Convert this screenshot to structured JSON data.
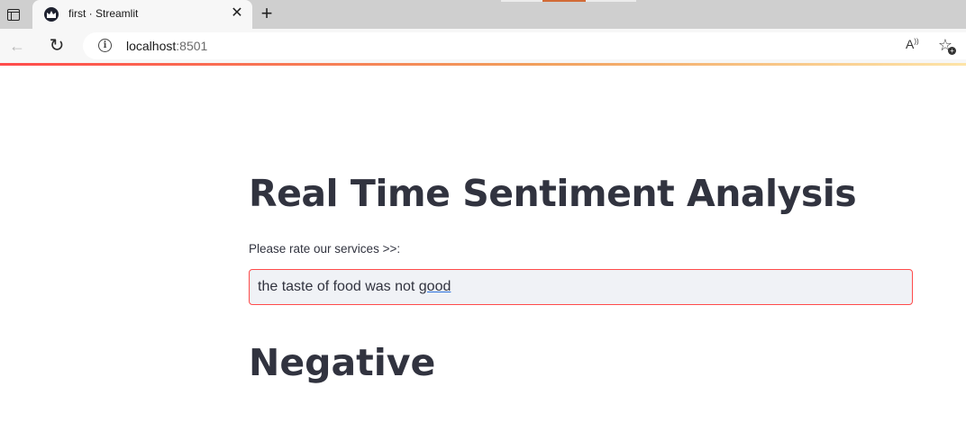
{
  "browser": {
    "tab": {
      "title": "first · Streamlit",
      "close_glyph": "✕"
    },
    "new_tab_glyph": "+",
    "back_glyph": "←",
    "reload_glyph": "↻",
    "info_glyph": "i",
    "address": {
      "host": "localhost",
      "port": ":8501"
    },
    "read_aloud_glyph": "A",
    "favorites_glyph": "☆",
    "favorites_plus": "+"
  },
  "app": {
    "title": "Real Time Sentiment Analysis",
    "input_label": "Please rate our services >>:",
    "input_value_plain": "the taste of food was not ",
    "input_value_flagged": "good",
    "result": "Negative",
    "colors": {
      "accent": "#ff4b4b",
      "text": "#31333f",
      "input_bg": "#f0f2f6"
    }
  }
}
